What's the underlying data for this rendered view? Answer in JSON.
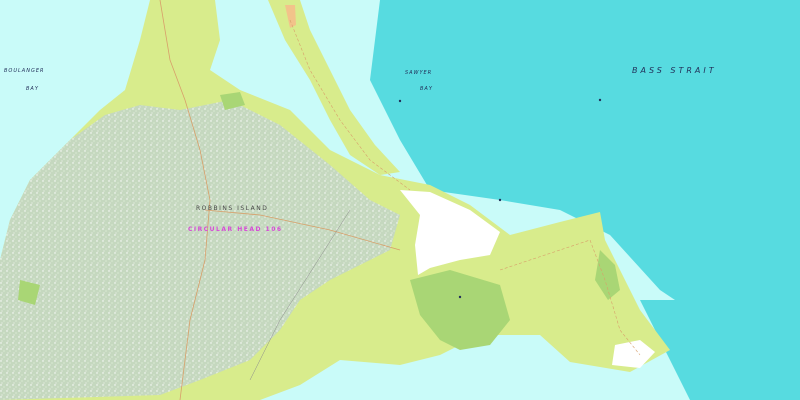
{
  "colors": {
    "water": "#c9fbf9",
    "deep_water": "#3fd3d9",
    "land_green": "#d8ec8c",
    "forest_grey": "#c5d8bf",
    "scrub": "#a9d675",
    "cleared": "#ffffff",
    "road": "#d89f6a",
    "poi": "#d64bd6"
  },
  "labels": {
    "bay_west": "BOULANGER",
    "bay_west_2": "BAY",
    "bay_center": "SAWYER",
    "bay_center_2": "BAY",
    "strait": "BASS     STRAIT",
    "island": "ROBBINS     ISLAND",
    "poi": "CIRCULAR HEAD 106"
  }
}
